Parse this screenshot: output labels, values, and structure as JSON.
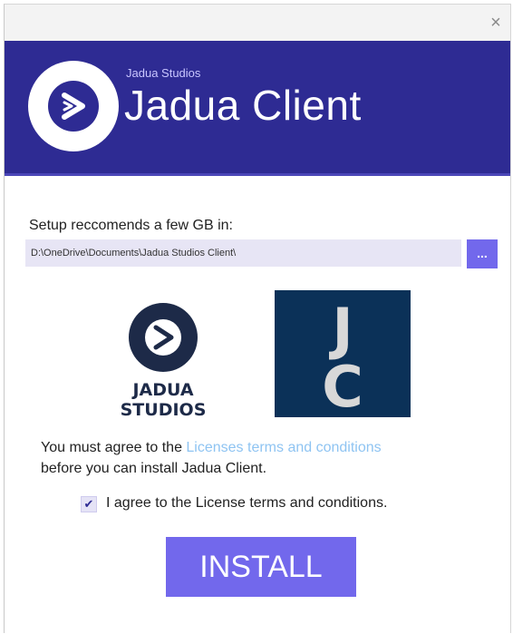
{
  "window": {
    "close_label": "×"
  },
  "header": {
    "publisher": "Jadua Studios",
    "title": "Jadua Client"
  },
  "setup": {
    "label": "Setup reccomends a few GB in:",
    "path_value": "D:\\OneDrive\\Documents\\Jadua Studios Client\\",
    "browse_label": "..."
  },
  "logos": {
    "studios_line1": "JADUA",
    "studios_line2": "STUDIOS",
    "jc_letter1": "J",
    "jc_letter2": "C"
  },
  "agreement": {
    "prefix": "You must agree to the ",
    "link": "Licenses terms and conditions",
    "suffix": "before you can install Jadua Client.",
    "checkbox_checked": true,
    "checkbox_mark": "✔",
    "checkbox_label": "I agree to the License terms and conditions."
  },
  "install": {
    "label": "INSTALL"
  },
  "colors": {
    "header_bg": "#2e2b93",
    "accent": "#7268ec",
    "link": "#8fc4f2",
    "jc_bg": "#0b3158"
  },
  "icons": {
    "close": "close-icon",
    "app_logo": "jadua-chevron-icon"
  }
}
